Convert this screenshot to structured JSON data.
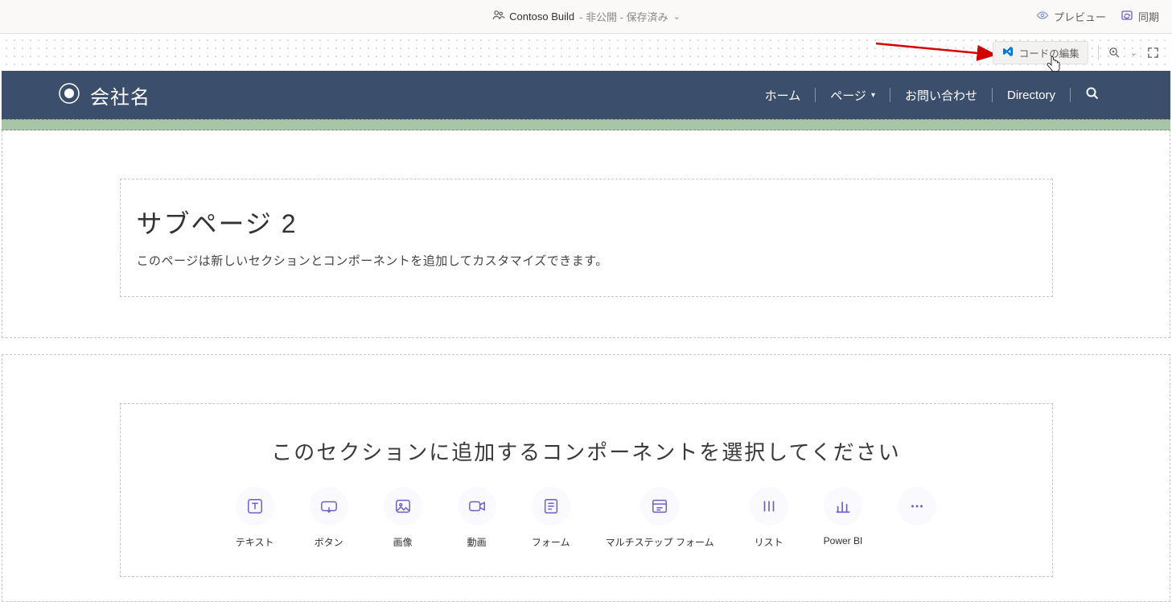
{
  "app_bar": {
    "site_name": "Contoso Build",
    "status": "- 非公開 - 保存済み",
    "preview": "プレビュー",
    "sync": "同期"
  },
  "canvas_toolbar": {
    "edit_code": "コードの編集"
  },
  "site_header": {
    "company": "会社名",
    "nav": {
      "home": "ホーム",
      "pages": "ページ",
      "contact": "お問い合わせ",
      "directory": "Directory"
    }
  },
  "section1": {
    "title": "サブページ 2",
    "desc": "このページは新しいセクションとコンポーネントを追加してカスタマイズできます。"
  },
  "picker": {
    "title": "このセクションに追加するコンポーネントを選択してください",
    "items": {
      "text": "テキスト",
      "button": "ボタン",
      "image": "画像",
      "video": "動画",
      "form": "フォーム",
      "multistep": "マルチステップ フォーム",
      "list": "リスト",
      "powerbi": "Power BI"
    }
  }
}
